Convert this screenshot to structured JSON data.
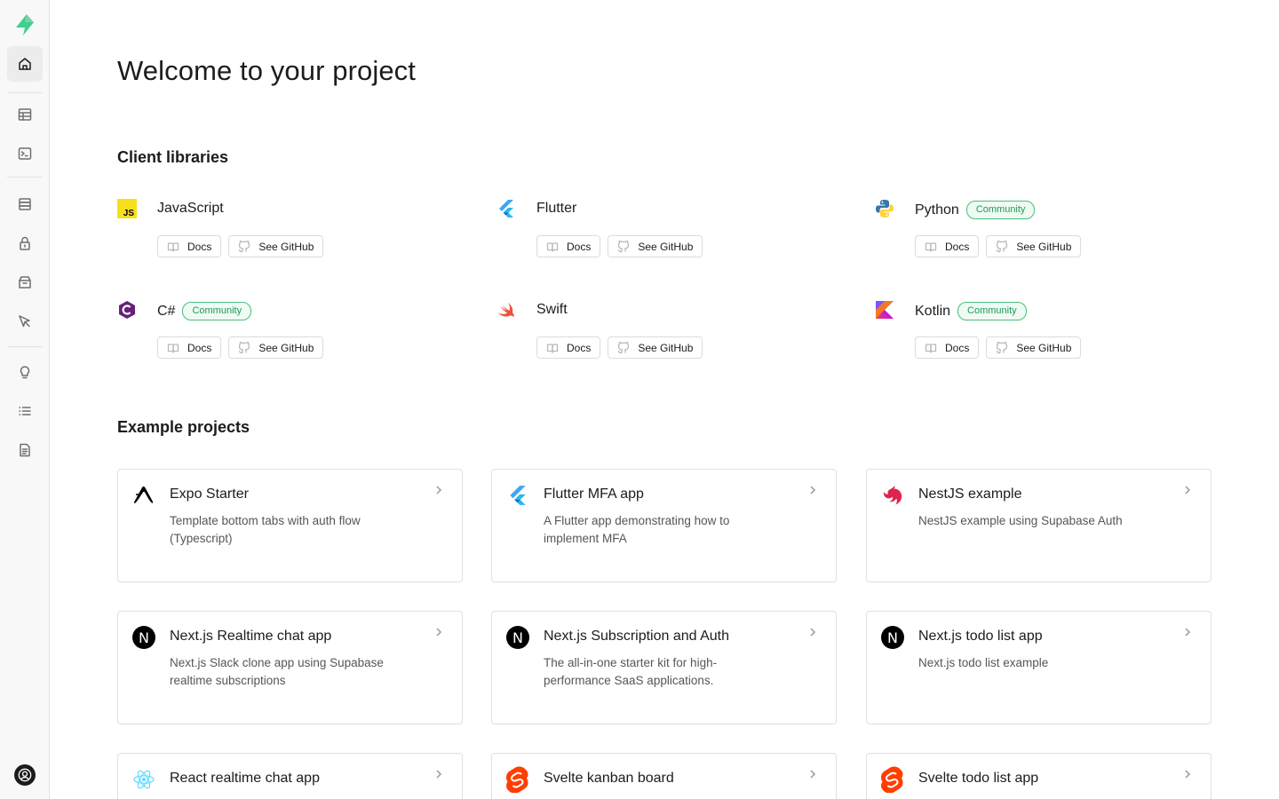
{
  "sidebar": {
    "logo": "supabase-logo-icon",
    "items": [
      {
        "name": "home",
        "icon": "home-icon",
        "active": true
      },
      {
        "name": "table-editor",
        "icon": "table-icon"
      },
      {
        "name": "sql-editor",
        "icon": "terminal-icon"
      },
      {
        "name": "database",
        "icon": "database-icon"
      },
      {
        "name": "authentication",
        "icon": "lock-icon"
      },
      {
        "name": "storage",
        "icon": "archive-icon"
      },
      {
        "name": "edge-functions",
        "icon": "pointer-icon"
      },
      {
        "name": "advisors",
        "icon": "lightbulb-icon"
      },
      {
        "name": "logs",
        "icon": "list-icon"
      },
      {
        "name": "api-docs",
        "icon": "document-icon"
      }
    ],
    "account_icon": "account-icon"
  },
  "page": {
    "title": "Welcome to your project"
  },
  "client_libraries": {
    "title": "Client libraries",
    "docs_label": "Docs",
    "github_label": "See GitHub",
    "items": [
      {
        "name": "JavaScript",
        "badge": ""
      },
      {
        "name": "Flutter",
        "badge": ""
      },
      {
        "name": "Python",
        "badge": "Community"
      },
      {
        "name": "C#",
        "badge": "Community"
      },
      {
        "name": "Swift",
        "badge": ""
      },
      {
        "name": "Kotlin",
        "badge": "Community"
      }
    ]
  },
  "example_projects": {
    "title": "Example projects",
    "items": [
      {
        "title": "Expo Starter",
        "description": "Template bottom tabs with auth flow (Typescript)",
        "icon": "expo-icon"
      },
      {
        "title": "Flutter MFA app",
        "description": "A Flutter app demonstrating how to implement MFA",
        "icon": "flutter-icon"
      },
      {
        "title": "NestJS example",
        "description": "NestJS example using Supabase Auth",
        "icon": "nestjs-icon"
      },
      {
        "title": "Next.js Realtime chat app",
        "description": "Next.js Slack clone app using Supabase realtime subscriptions",
        "icon": "nextjs-icon"
      },
      {
        "title": "Next.js Subscription and Auth",
        "description": "The all-in-one starter kit for high-performance SaaS applications.",
        "icon": "nextjs-icon"
      },
      {
        "title": "Next.js todo list app",
        "description": "Next.js todo list example",
        "icon": "nextjs-icon"
      },
      {
        "title": "React realtime chat app",
        "description": "",
        "icon": "react-icon"
      },
      {
        "title": "Svelte kanban board",
        "description": "",
        "icon": "svelte-icon"
      },
      {
        "title": "Svelte todo list app",
        "description": "",
        "icon": "svelte-icon"
      }
    ],
    "nextjs_glyph": "N"
  },
  "colors": {
    "brand": "#3ecf8e",
    "community_badge": "#1f9b58"
  }
}
